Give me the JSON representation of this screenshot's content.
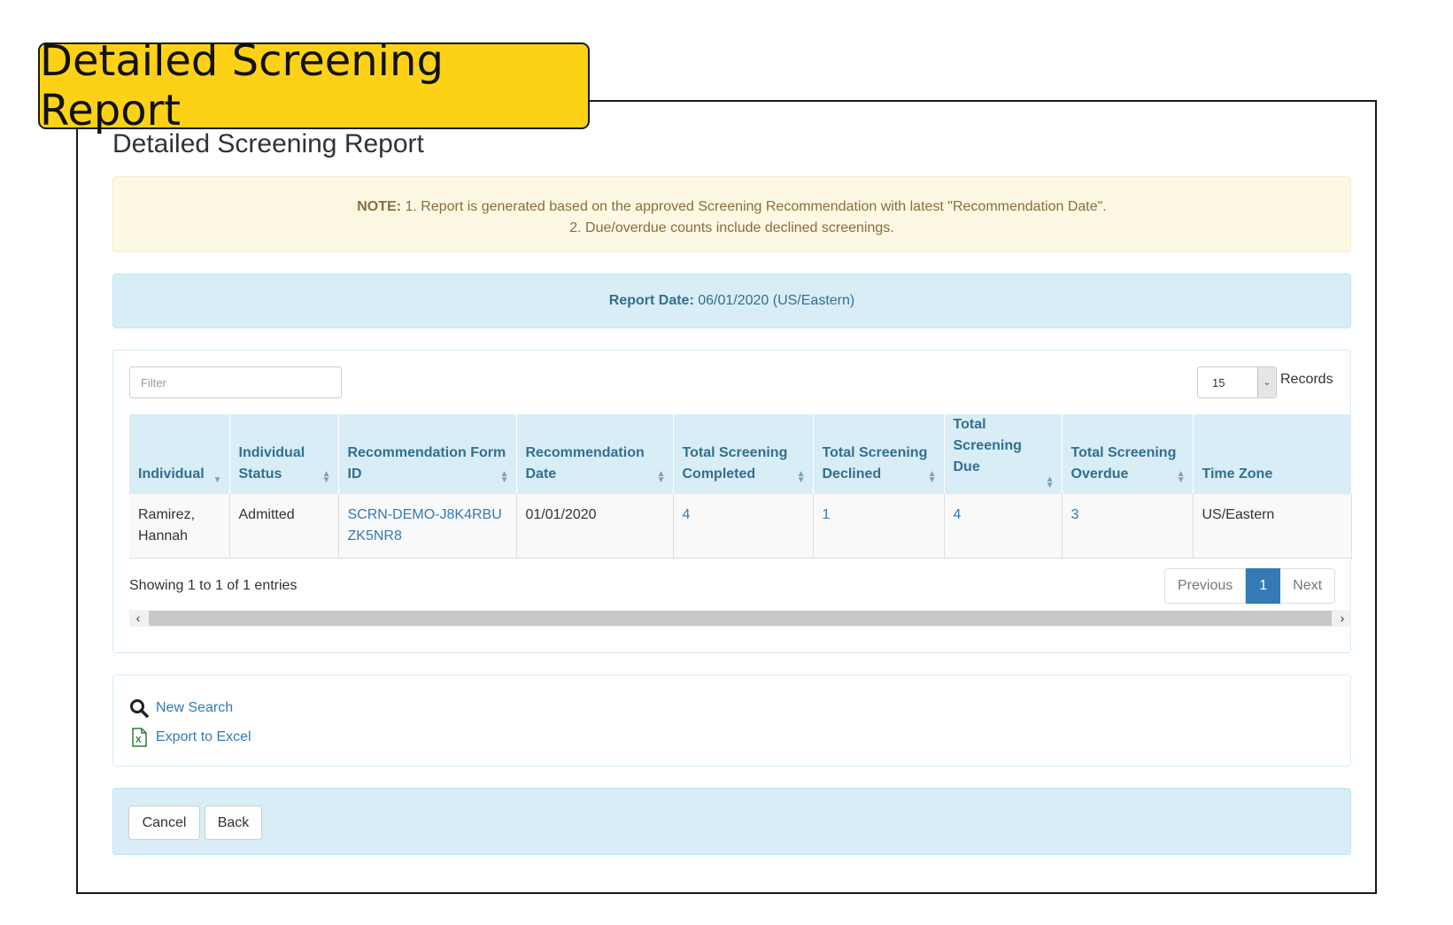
{
  "callout": {
    "title": "Detailed Screening Report"
  },
  "page": {
    "title": "Detailed Screening Report"
  },
  "note": {
    "label": "NOTE:",
    "line1": " 1. Report is generated based on the approved Screening Recommendation with latest \"Recommendation Date\".",
    "line2": "2. Due/overdue counts include declined screenings."
  },
  "report_date": {
    "label": "Report Date:",
    "value": " 06/01/2020 (US/Eastern)"
  },
  "filter": {
    "placeholder": "Filter",
    "value": ""
  },
  "records": {
    "selected": "15",
    "label": "Records"
  },
  "table": {
    "headers": [
      "Individual",
      "Individual Status",
      "Recommendation Form ID",
      "Recommendation Date",
      "Total Screening Completed",
      "Total Screening Declined",
      "Total Screening Due",
      "Total Screening Overdue",
      "Time Zone"
    ],
    "rows": [
      {
        "individual": "Ramirez, Hannah",
        "status": "Admitted",
        "form_id": "SCRN-DEMO-J8K4RBUZK5NR8",
        "rec_date": "01/01/2020",
        "completed": "4",
        "declined": "1",
        "due": "4",
        "overdue": "3",
        "time_zone": "US/Eastern"
      }
    ]
  },
  "pagination": {
    "summary": "Showing 1 to 1 of 1 entries",
    "previous": "Previous",
    "current": "1",
    "next": "Next"
  },
  "actions": {
    "new_search": "New Search",
    "export": "Export to Excel"
  },
  "buttons": {
    "cancel": "Cancel",
    "back": "Back"
  },
  "icons": {
    "search": "search-icon",
    "excel": "excel-icon",
    "sort": "sort-icon",
    "sort_desc": "sort-desc-icon",
    "caret": "chevron-down-icon"
  },
  "colors": {
    "callout": "#fdd216",
    "info_bg": "#d9edf7",
    "info_text": "#31708f",
    "warning_bg": "#fcf8e3",
    "warning_text": "#8a6d3b",
    "link": "#337ab7"
  }
}
